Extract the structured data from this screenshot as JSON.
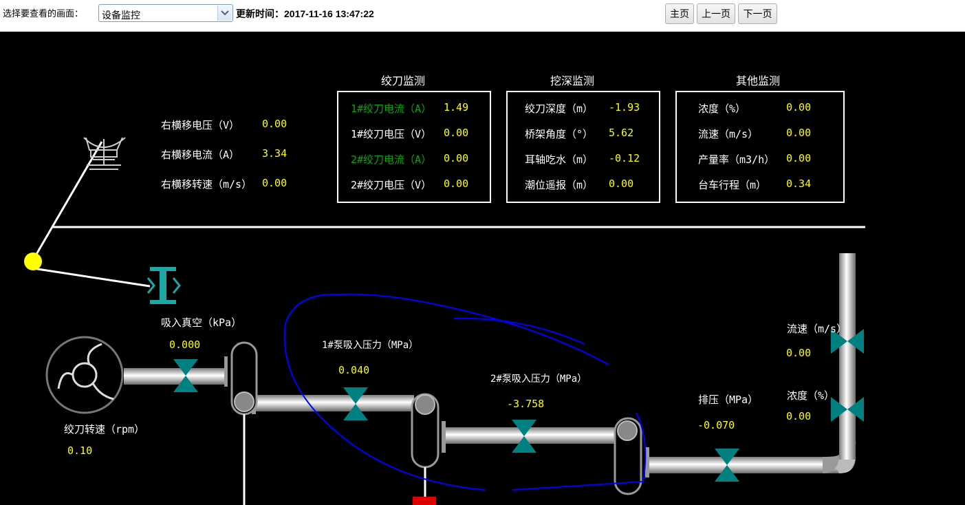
{
  "toolbar": {
    "select_label": "选择要查看的画面：",
    "select_value": "设备监控",
    "update_time": "更新时间：2017-11-16 13:47:22",
    "btn_home": "主页",
    "btn_prev": "上一页",
    "btn_next": "下一页"
  },
  "panels": {
    "cutter": {
      "title": "绞刀监测",
      "rows": [
        {
          "label": "1#绞刀电流（A）",
          "value": "1.49"
        },
        {
          "label": "1#绞刀电压（V）",
          "value": "0.00"
        },
        {
          "label": "2#绞刀电流（A）",
          "value": "0.00"
        },
        {
          "label": "2#绞刀电压（V）",
          "value": "0.00"
        }
      ]
    },
    "depth": {
      "title": "挖深监测",
      "rows": [
        {
          "label": "绞刀深度（m）",
          "value": "-1.93"
        },
        {
          "label": "桥架角度（°）",
          "value": "5.62"
        },
        {
          "label": "耳轴吃水（m）",
          "value": "-0.12"
        },
        {
          "label": "潮位遥报（m）",
          "value": "0.00"
        }
      ]
    },
    "other": {
      "title": "其他监测",
      "rows": [
        {
          "label": "浓度（%）",
          "value": "0.00"
        },
        {
          "label": "流速（m/s）",
          "value": "0.00"
        },
        {
          "label": "产量率（m3/h）",
          "value": "0.00"
        },
        {
          "label": "台车行程（m）",
          "value": "0.34"
        }
      ]
    }
  },
  "traverse": {
    "rows": [
      {
        "label": "右横移电压（V）",
        "value": "0.00"
      },
      {
        "label": "右横移电流（A）",
        "value": "3.34"
      },
      {
        "label": "右横移转速（m/s）",
        "value": "0.00"
      }
    ]
  },
  "process": {
    "vacuum_label": "吸入真空（kPa）",
    "vacuum_value": "0.000",
    "cutter_speed_label": "绞刀转速（rpm）",
    "cutter_speed_value": "0.10",
    "pump1_label": "1#泵吸入压力（MPa）",
    "pump1_value": "0.040",
    "pump2_label": "2#泵吸入压力（MPa）",
    "pump2_value": "-3.758",
    "discharge_label": "排压（MPa）",
    "discharge_value": "-0.070",
    "flow_label": "流速（m/s）",
    "flow_value": "0.00",
    "density_label": "浓度（%）",
    "density_value": "0.00"
  },
  "colors": {
    "background": "#000000",
    "value": "#ffff00",
    "highlight_label": "#00aa00",
    "valve": "#008080",
    "annotation": "#0000ff"
  }
}
